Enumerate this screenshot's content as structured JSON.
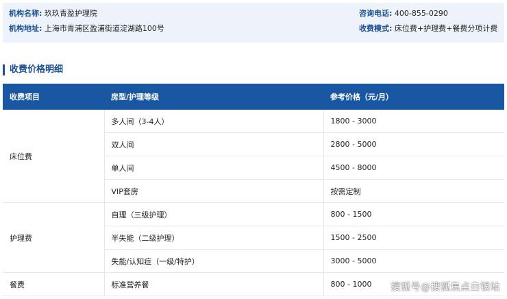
{
  "info": {
    "name_label": "机构名称:",
    "name_value": "玖玖青盈护理院",
    "address_label": "机构地址:",
    "address_value": "上海市青浦区盈浦街道淀湖路100号",
    "phone_label": "咨询电话:",
    "phone_value": "400-855-0290",
    "mode_label": "收费模式:",
    "mode_value": "床位费+护理费+餐费分项计费"
  },
  "section": {
    "title": "收费价格明细"
  },
  "table": {
    "headers": [
      "收费项目",
      "房型/护理等级",
      "参考价格（元/月）"
    ],
    "groups": [
      {
        "category": "床位费",
        "rows": [
          {
            "level": "多人间（3-4人）",
            "price": "1800 - 3000"
          },
          {
            "level": "双人间",
            "price": "2800 - 5000"
          },
          {
            "level": "单人间",
            "price": "4500 - 8000"
          },
          {
            "level": "VIP套房",
            "price": "按需定制"
          }
        ]
      },
      {
        "category": "护理费",
        "rows": [
          {
            "level": "自理（三级护理）",
            "price": "800 - 1500"
          },
          {
            "level": "半失能（二级护理）",
            "price": "1500 - 2500"
          },
          {
            "level": "失能/认知症（一级/特护）",
            "price": "3000 - 5000"
          }
        ]
      },
      {
        "category": "餐费",
        "rows": [
          {
            "level": "标准营养餐",
            "price": "800 - 1000"
          }
        ]
      }
    ]
  },
  "watermark": "搜狐号@搜狐焦点白银站"
}
